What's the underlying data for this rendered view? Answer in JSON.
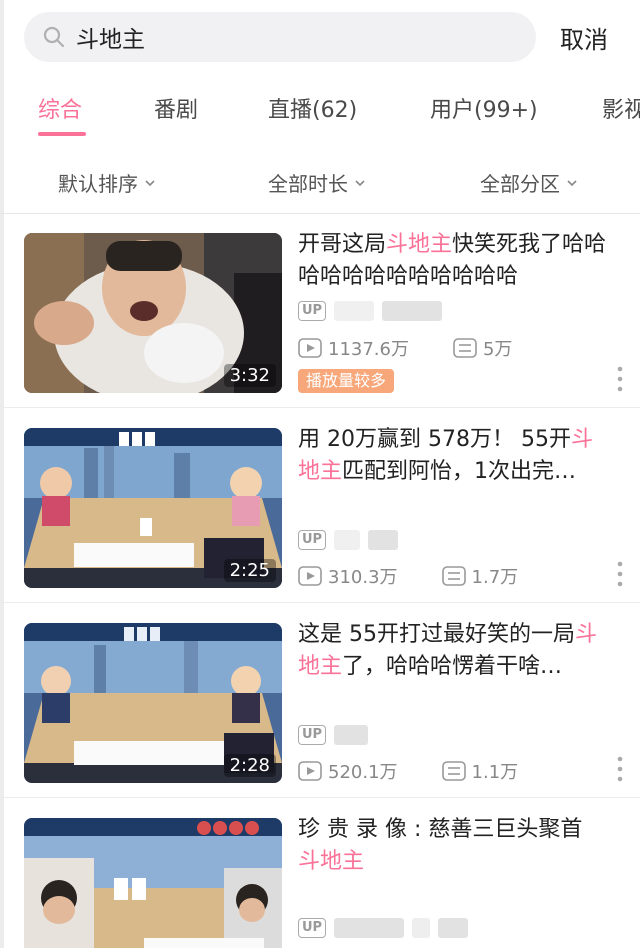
{
  "search": {
    "query": "斗地主",
    "cancel_label": "取消"
  },
  "tabs": [
    {
      "label": "综合",
      "active": true
    },
    {
      "label": "番剧",
      "active": false
    },
    {
      "label": "直播(62)",
      "active": false
    },
    {
      "label": "用户(99+)",
      "active": false
    },
    {
      "label": "影视",
      "active": false
    }
  ],
  "filters": [
    {
      "label": "默认排序"
    },
    {
      "label": "全部时长"
    },
    {
      "label": "全部分区"
    }
  ],
  "colors": {
    "accent": "#fb7299",
    "badge": "#f7a77a"
  },
  "videos": [
    {
      "title_before": "开哥这局",
      "title_highlight": "斗地主",
      "title_after": "快笑死我了哈哈哈哈哈哈哈哈哈哈哈哈",
      "duration": "3:32",
      "up_label": "UP",
      "views": "1137.6万",
      "comments": "5万",
      "badge": "播放量较多"
    },
    {
      "title_before": "用 20万赢到 578万！ 55开",
      "title_highlight": "斗地主",
      "title_after": "匹配到阿怡，1次出完…",
      "duration": "2:25",
      "up_label": "UP",
      "views": "310.3万",
      "comments": "1.7万"
    },
    {
      "title_before": "这是 55开打过最好笑的一局",
      "title_highlight": "斗地主",
      "title_after": "了，哈哈哈愣着干啥…",
      "duration": "2:28",
      "up_label": "UP",
      "views": "520.1万",
      "comments": "1.1万"
    },
    {
      "title_before": "珍 贵 录 像 : 慈善三巨头聚首",
      "title_highlight": "斗地主",
      "title_after": "",
      "up_label": "UP"
    }
  ]
}
